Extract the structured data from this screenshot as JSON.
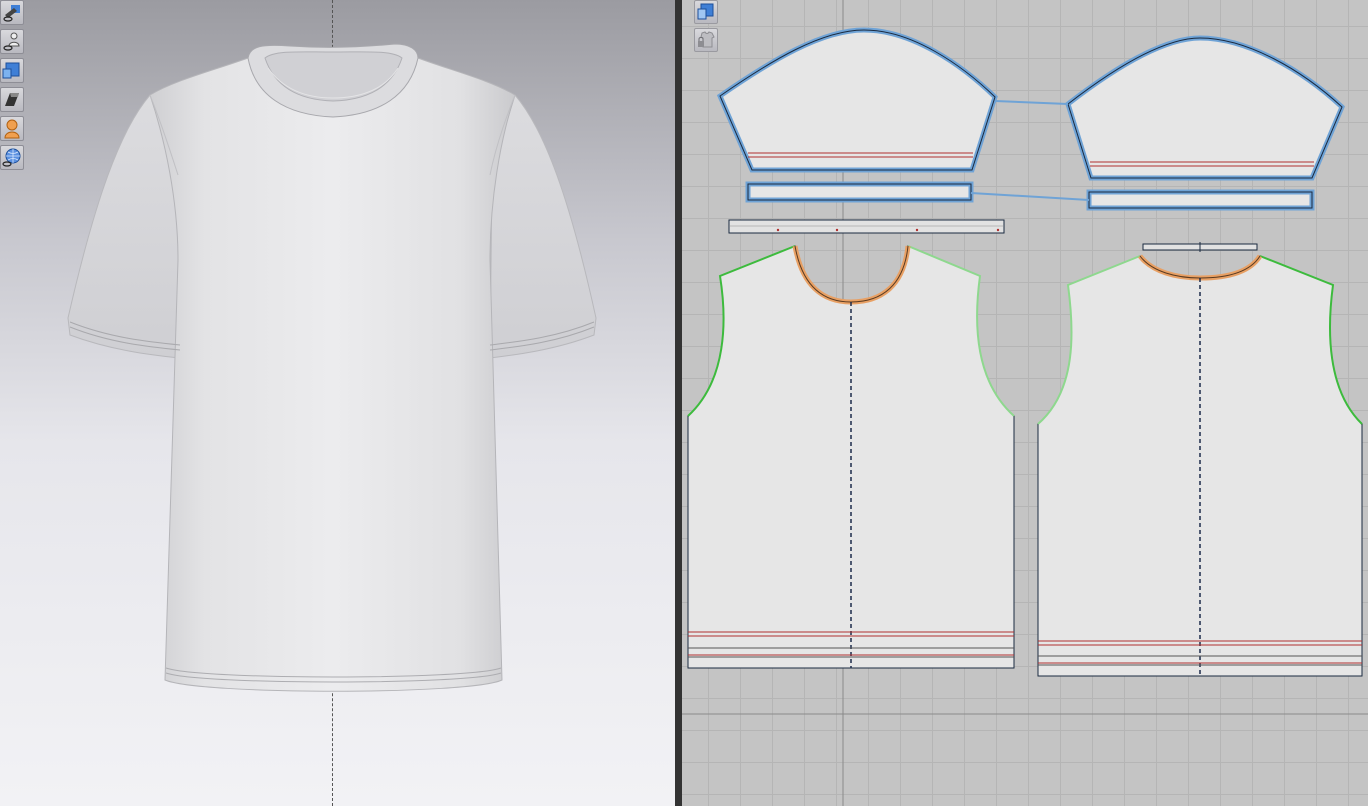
{
  "app": {
    "layout": "split-3d-2d"
  },
  "colors": {
    "viewport3d_top": "#9b9ba1",
    "viewport3d_bottom": "#f2f2f5",
    "grid_bg": "#c4c4c4",
    "fabric": "#e6e6e6",
    "selected_outline": "#6fa3d6",
    "armhole_seam": "#3dbb3d",
    "neckline_seam": "#e8a064",
    "hem_line": "#b03030",
    "grain_line": "#1b2a4a"
  },
  "toolbar3d": {
    "buttons": [
      {
        "icon": "show-fabric-icon"
      },
      {
        "icon": "show-avatar-icon"
      },
      {
        "icon": "garment-view-icon"
      },
      {
        "icon": "fabric-texture-icon"
      },
      {
        "icon": "avatar-icon"
      },
      {
        "icon": "world-grid-icon"
      }
    ]
  },
  "toolbar2d": {
    "buttons": [
      {
        "icon": "pattern-view-icon"
      },
      {
        "icon": "lock-garment-icon"
      }
    ]
  },
  "garment": {
    "name": "",
    "pieces": [
      {
        "id": "sleeve-left",
        "type": "sleeve",
        "selected": true
      },
      {
        "id": "sleeve-right",
        "type": "sleeve",
        "selected": true
      },
      {
        "id": "cuff-left",
        "type": "cuff",
        "selected": true
      },
      {
        "id": "cuff-right",
        "type": "cuff",
        "selected": true
      },
      {
        "id": "neckband-front",
        "type": "binding",
        "selected": false
      },
      {
        "id": "neckband-back",
        "type": "binding",
        "selected": false
      },
      {
        "id": "front-body",
        "type": "body",
        "selected": false
      },
      {
        "id": "back-body",
        "type": "body",
        "selected": false
      }
    ]
  }
}
